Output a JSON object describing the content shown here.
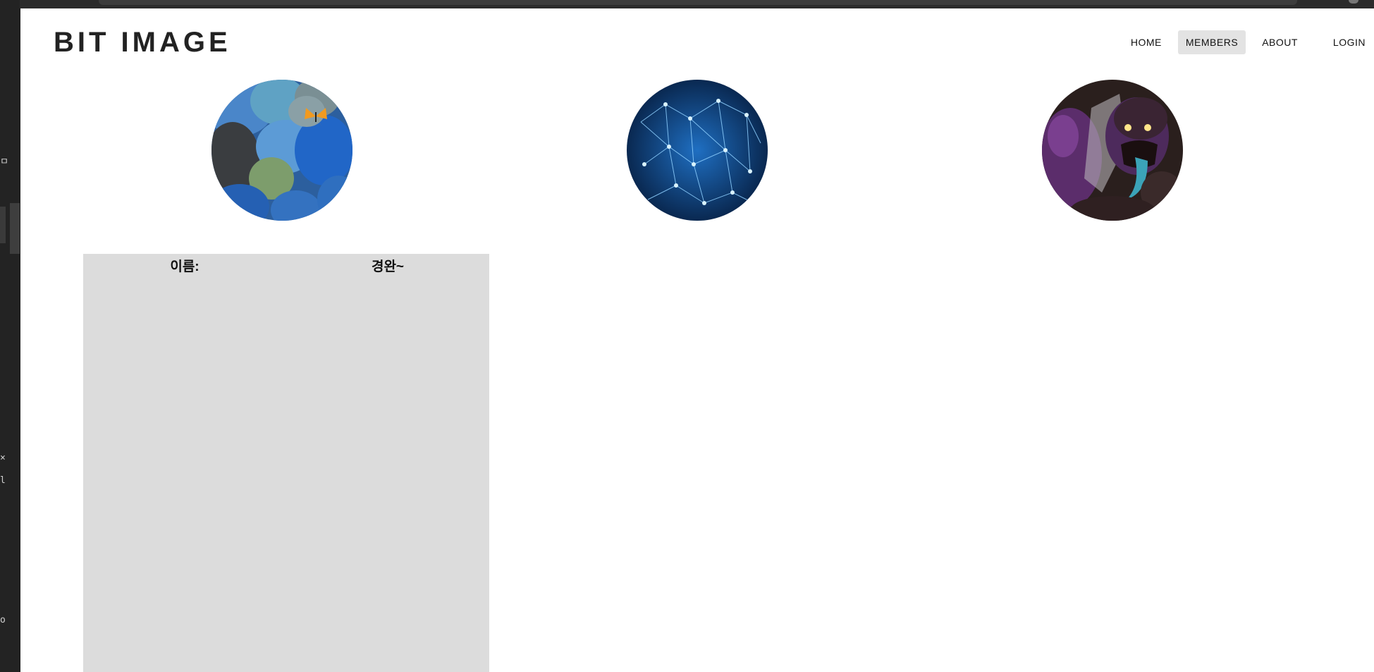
{
  "site": {
    "logo": "BIT IMAGE"
  },
  "nav": {
    "items": [
      {
        "label": "HOME",
        "active": false
      },
      {
        "label": "MEMBERS",
        "active": true
      },
      {
        "label": "ABOUT",
        "active": false
      },
      {
        "label": "LOGIN",
        "active": false
      }
    ]
  },
  "members": [
    {
      "image": "blue-pebbles-butterfly"
    },
    {
      "image": "blue-network-mesh"
    },
    {
      "image": "purple-monster-character"
    }
  ],
  "detail": {
    "name_label": "이름:",
    "name_value": "경완~"
  },
  "editor_strip": {
    "glyphs": [
      "ㅁ",
      "×",
      "l",
      "o"
    ]
  },
  "colors": {
    "page_bg": "#ffffff",
    "card_bg": "#dcdcdc",
    "active_nav_bg": "#e3e3e3",
    "logo_text": "#222222"
  }
}
